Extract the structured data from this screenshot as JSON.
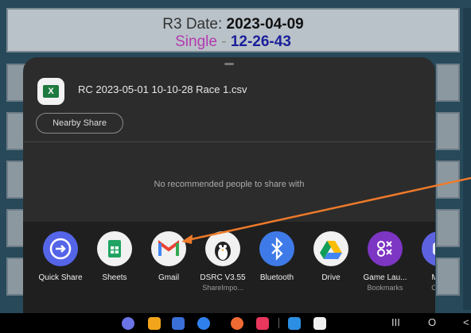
{
  "background": {
    "title_date_label": "R3 Date:",
    "title_date": "2023-04-09",
    "title_single": "Single",
    "title_dash": "-",
    "title_race": "12-26-43"
  },
  "share": {
    "file_name": "RC 2023-05-01 10-10-28 Race 1.csv",
    "nearby_share": "Nearby Share",
    "no_recommend": "No recommended people to share with",
    "apps": [
      {
        "label": "Quick Share",
        "sub": "",
        "icon": "quick-share-icon",
        "color": "#5565e8"
      },
      {
        "label": "Sheets",
        "sub": "",
        "icon": "sheets-icon",
        "color": "#f1f1f1"
      },
      {
        "label": "Gmail",
        "sub": "",
        "icon": "gmail-icon",
        "color": "#f1f1f1"
      },
      {
        "label": "DSRC V3.55",
        "sub": "ShareImpo...",
        "icon": "dsrc-penguin-icon",
        "color": "#f1f1f1"
      },
      {
        "label": "Bluetooth",
        "sub": "",
        "icon": "bluetooth-icon",
        "color": "#3f7be8"
      },
      {
        "label": "Drive",
        "sub": "",
        "icon": "drive-icon",
        "color": "#f1f1f1"
      },
      {
        "label": "Game Lau...",
        "sub": "Bookmarks",
        "icon": "game-launcher-icon",
        "color": "#7d35c4"
      },
      {
        "label": "Micr",
        "sub": "Crea",
        "icon": "microsoft-icon",
        "color": "#5d63e0"
      }
    ]
  },
  "taskbar": {
    "nav_recent": "III",
    "nav_home": "O",
    "nav_back": "<"
  },
  "colors": {
    "accent_arrow": "#ee7a2a",
    "sheet_bg": "#2c2c2c"
  }
}
